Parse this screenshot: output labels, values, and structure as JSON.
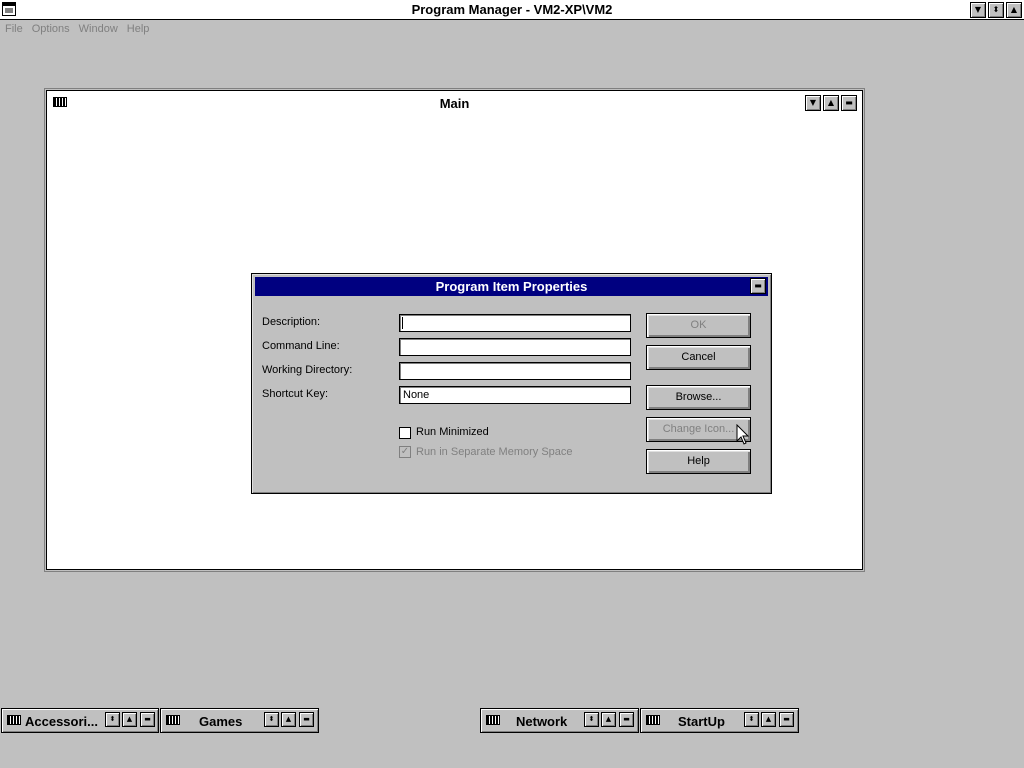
{
  "app": {
    "title": "Program Manager - VM2-XP\\VM2"
  },
  "menu": [
    "File",
    "Options",
    "Window",
    "Help"
  ],
  "title_buttons": {
    "minimize": "▼",
    "restore": "⬍",
    "close_group": "▲",
    "bar": "▬"
  },
  "main_window": {
    "title": "Main"
  },
  "dialog": {
    "title": "Program Item Properties",
    "fields": {
      "description_label": "Description:",
      "description_value": "",
      "command_line_label": "Command Line:",
      "command_line_value": "",
      "working_directory_label": "Working Directory:",
      "working_directory_value": "",
      "shortcut_key_label": "Shortcut Key:",
      "shortcut_key_value": "None"
    },
    "checkboxes": {
      "run_minimized": {
        "label": "Run Minimized",
        "checked": false
      },
      "separate_memory": {
        "label": "Run in Separate Memory Space",
        "checked": true,
        "mark": "✓"
      }
    },
    "buttons": {
      "ok": "OK",
      "cancel": "Cancel",
      "browse": "Browse...",
      "change_icon": "Change Icon...",
      "help": "Help"
    }
  },
  "minimized_groups": [
    "Accessori...",
    "Games",
    "Network",
    "StartUp"
  ],
  "colors": {
    "desktop": "#c0c0c0",
    "dialog_title": "#000080",
    "disabled_text": "#808080"
  }
}
